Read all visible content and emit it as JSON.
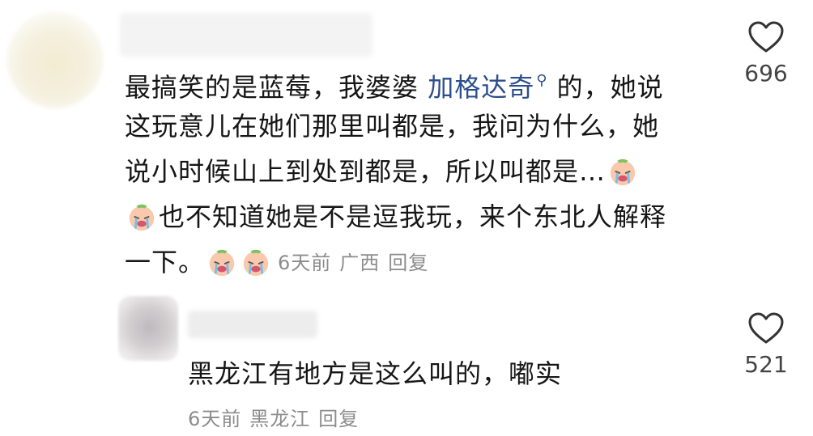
{
  "comments": [
    {
      "text_lines": [
        [
          "最搞笑的是蓝莓，我婆婆 ",
          "加格达奇",
          " 的，她说"
        ],
        "这玩意儿在她们那里叫都是，我问为什么，她",
        "说小时候山上到处到都是，所以叫都是…",
        "也不知道她是不是逗我玩，来个东北人解释",
        "一下。"
      ],
      "mention": "加格达奇",
      "time": "6天前",
      "location": "广西",
      "reply_label": "回复",
      "likes": "696",
      "emojis": [
        "crying-face-emoji",
        "crying-face-emoji",
        "crying-face-emoji",
        "crying-face-emoji"
      ]
    },
    {
      "text": "黑龙江有地方是这么叫的，嘟实",
      "time": "6天前",
      "location": "黑龙江",
      "reply_label": "回复",
      "likes": "521"
    }
  ],
  "icons": {
    "like": "heart-outline-icon",
    "mention": "search-icon"
  },
  "colors": {
    "mention": "#2c4e8c",
    "meta": "#8c8c8c",
    "text": "#161616"
  }
}
